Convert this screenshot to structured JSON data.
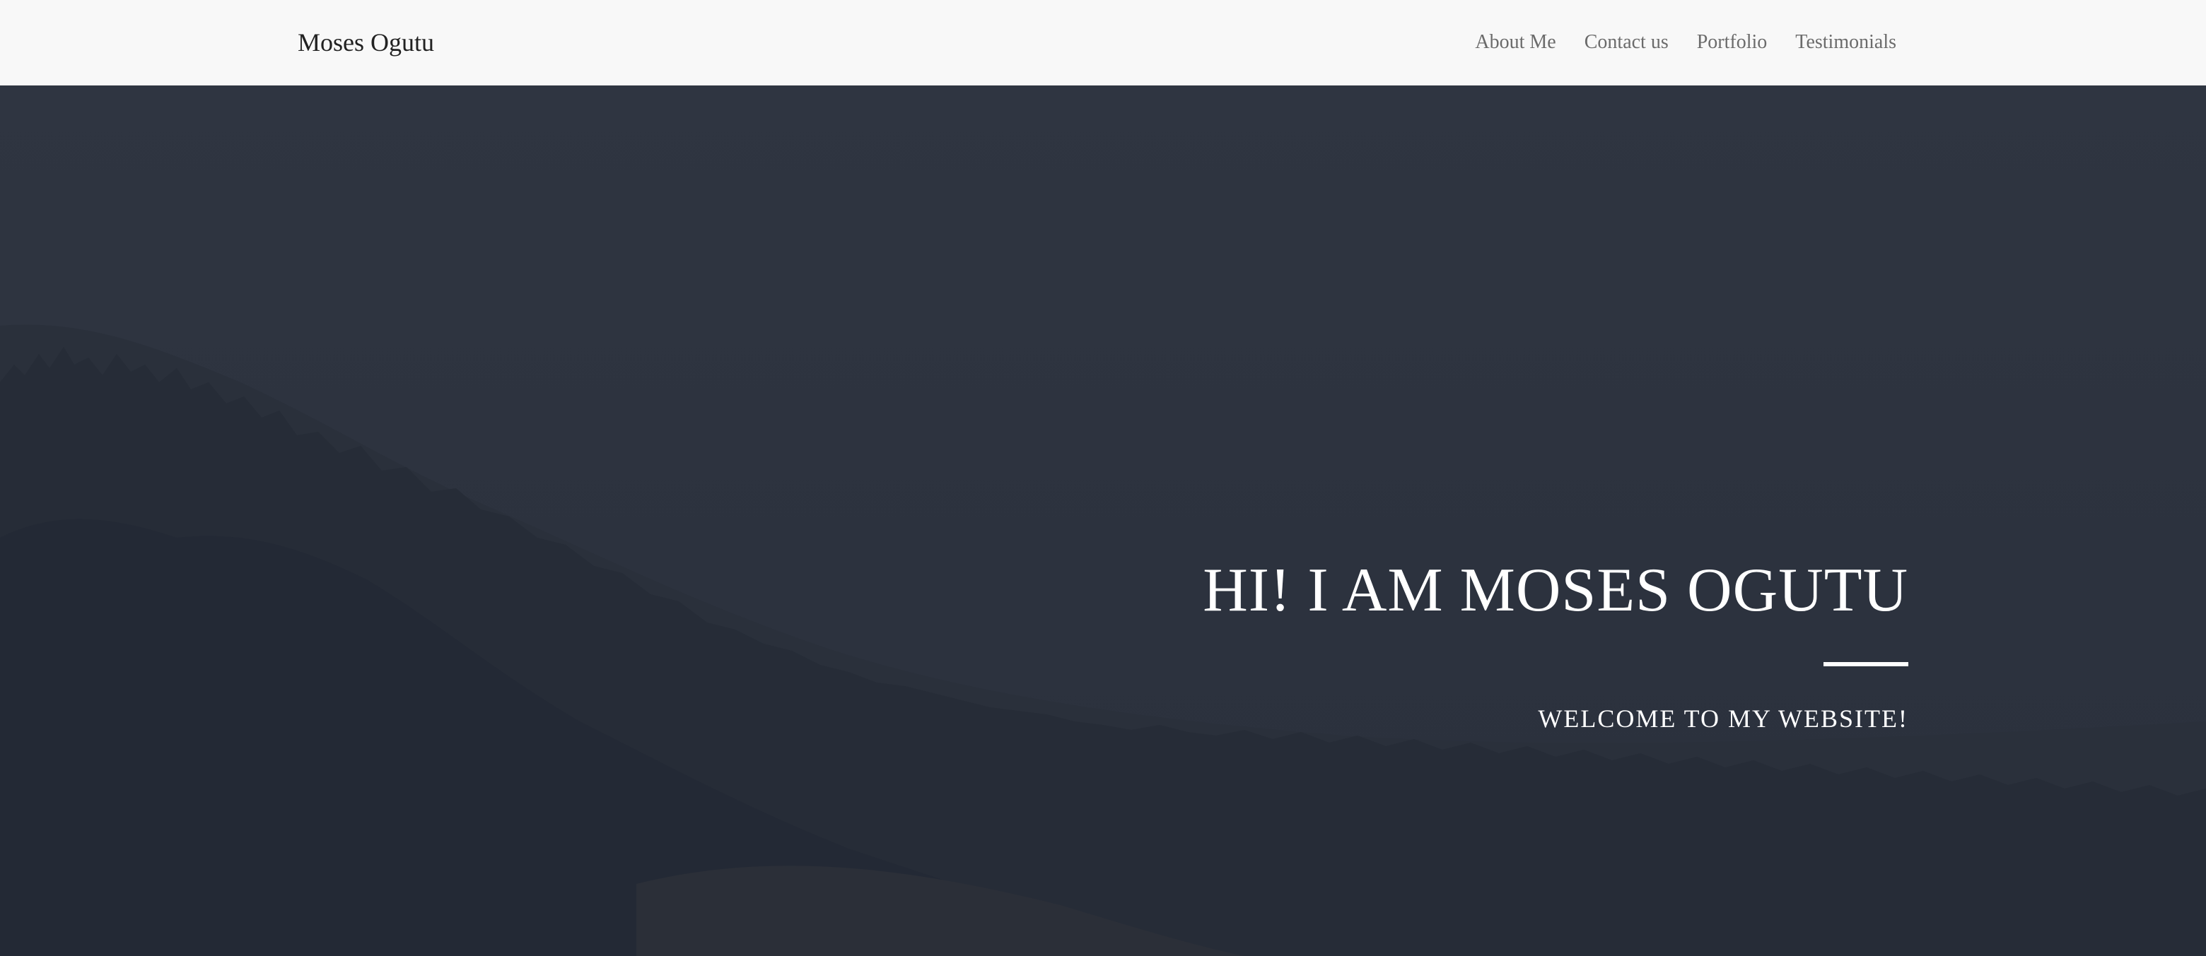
{
  "navbar": {
    "brand": "Moses Ogutu",
    "links": [
      {
        "label": "About Me"
      },
      {
        "label": "Contact us"
      },
      {
        "label": "Portfolio"
      },
      {
        "label": "Testimonials"
      }
    ]
  },
  "hero": {
    "title": "HI! I AM MOSES OGUTU",
    "subtitle": "WELCOME TO MY WEBSITE!"
  },
  "colors": {
    "navbar_bg": "#f8f8f8",
    "hero_overlay": "#2d3340",
    "hero_text": "#ffffff",
    "nav_link": "#6b6b6b"
  }
}
